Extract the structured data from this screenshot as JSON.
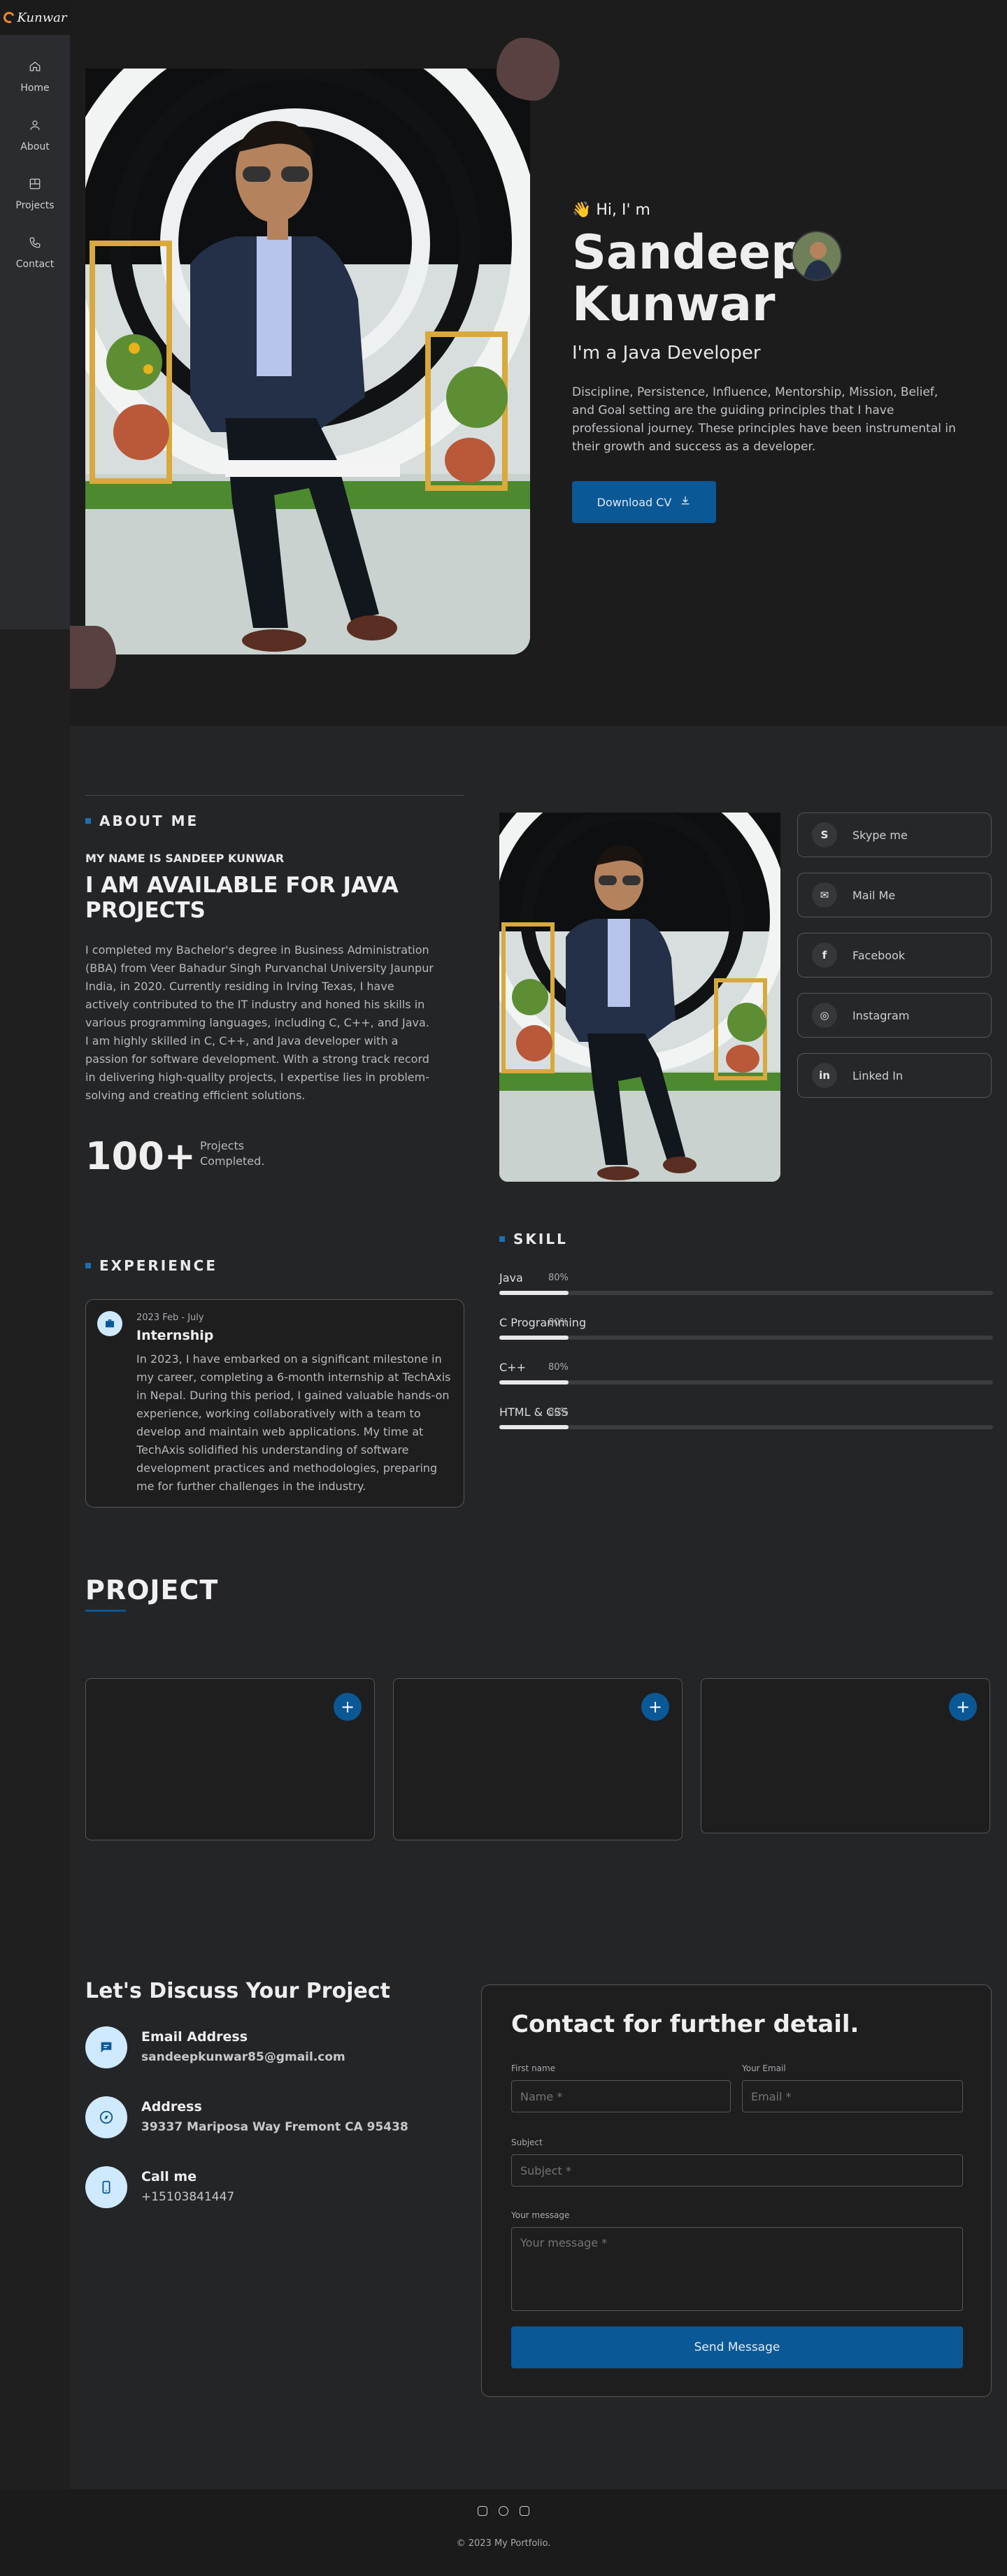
{
  "brand": {
    "logo_text": "Kunwar"
  },
  "nav": [
    {
      "label": "Home",
      "icon": "home-icon"
    },
    {
      "label": "About",
      "icon": "user-icon"
    },
    {
      "label": "Projects",
      "icon": "projects-icon"
    },
    {
      "label": "Contact",
      "icon": "phone-icon"
    }
  ],
  "hero": {
    "greeting": "👋 Hi, I' m",
    "name": "Sandeep Kunwar",
    "role": "I'm a Java Developer",
    "description": "Discipline, Persistence, Influence, Mentorship, Mission, Belief, and Goal setting are the guiding principles that I have professional journey. These principles have been instrumental in their growth and success as a developer.",
    "cv_button": "Download CV"
  },
  "about": {
    "label": "ABOUT ME",
    "subtitle": "MY NAME IS SANDEEP KUNWAR",
    "headline": "I AM AVAILABLE FOR JAVA PROJECTS",
    "text": "I completed my Bachelor's degree in Business Administration (BBA) from Veer Bahadur Singh Purvanchal University Jaunpur India, in 2020. Currently residing in Irving Texas, I have actively contributed to the IT industry and honed his skills in various programming languages, including C, C++, and Java. I am highly skilled in C, C++, and Java developer with a passion for software development. With a strong track record in delivering high-quality projects, I expertise lies in problem-solving and creating efficient solutions.",
    "count": "100+",
    "count_label": "Projects Completed."
  },
  "socials": [
    {
      "label": "Skype me",
      "icon": "skype-icon",
      "glyph": "S"
    },
    {
      "label": "Mail Me",
      "icon": "mail-icon",
      "glyph": "✉"
    },
    {
      "label": "Facebook",
      "icon": "facebook-icon",
      "glyph": "f"
    },
    {
      "label": "Instagram",
      "icon": "instagram-icon",
      "glyph": "◎"
    },
    {
      "label": "Linked In",
      "icon": "linkedin-icon",
      "glyph": "in"
    }
  ],
  "experience": {
    "label": "EXPERIENCE",
    "date": "2023 Feb - July",
    "title": "Internship",
    "text": "In 2023, I have embarked on a significant milestone in my career, completing a 6-month internship at TechAxis in Nepal. During this period, I gained valuable hands-on experience, working collaboratively with a team to develop and maintain web applications. My time at TechAxis solidified his understanding of software development practices and methodologies, preparing me for further challenges in the industry."
  },
  "skills": {
    "label": "SKILL",
    "items": [
      {
        "name": "Java",
        "percent_label": "80%",
        "level": 0.14
      },
      {
        "name": "C Programming",
        "percent_label": "80%",
        "level": 0.14
      },
      {
        "name": "C++",
        "percent_label": "80%",
        "level": 0.14
      },
      {
        "name": "HTML & CSS",
        "percent_label": "80%",
        "level": 0.14
      }
    ]
  },
  "project": {
    "title": "PROJECT",
    "plus": "+"
  },
  "contact": {
    "discuss_title": "Let's Discuss Your Project",
    "email_title": "Email Address",
    "email_value": "sandeepkunwar85@gmail.com",
    "address_title": "Address",
    "address_value": "39337 Mariposa Way Fremont CA 95438",
    "call_title": "Call me",
    "call_value": "+15103841447",
    "form_title": "Contact for further detail.",
    "first_name_label": "First name",
    "first_name_placeholder": "Name *",
    "email_label": "Your Email",
    "email_placeholder": "Email *",
    "subject_label": "Subject",
    "subject_placeholder": "Subject *",
    "message_label": "Your message",
    "message_placeholder": "Your message *",
    "send_button": "Send Message"
  },
  "footer": {
    "copyright": "© 2023 My Portfolio."
  },
  "colors": {
    "accent": "#0b5896",
    "background": "#242527",
    "hero_bg": "#1c1c1d",
    "blob": "#5a4141"
  }
}
